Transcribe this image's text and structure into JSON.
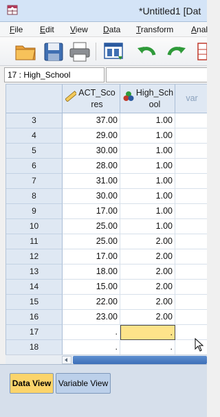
{
  "window": {
    "title": "*Untitled1 [Dat"
  },
  "menu": [
    {
      "label_u": "F",
      "label_rest": "ile"
    },
    {
      "label_u": "E",
      "label_rest": "dit"
    },
    {
      "label_u": "V",
      "label_rest": "iew"
    },
    {
      "label_u": "D",
      "label_rest": "ata"
    },
    {
      "label_u": "T",
      "label_rest": "ransform"
    },
    {
      "label_u": "A",
      "label_rest": "nal"
    }
  ],
  "toolbar": {
    "icons": [
      "open-folder-icon",
      "save-icon",
      "print-icon",
      "dialog-recall-icon",
      "undo-icon",
      "redo-icon",
      "goto-case-icon"
    ]
  },
  "reference_bar": {
    "cell_ref": "17 : High_School",
    "cell_value": ""
  },
  "grid": {
    "columns": [
      {
        "label_line1": "ACT_Sco",
        "label_line2": "res",
        "icon": "scale-ruler-icon"
      },
      {
        "label_line1": "High_Sch",
        "label_line2": "ool",
        "icon": "nominal-circles-icon"
      },
      {
        "label_line1": "var",
        "label_line2": ""
      }
    ],
    "rows": [
      {
        "num": "3",
        "act": "37.00",
        "hs": "1.00"
      },
      {
        "num": "4",
        "act": "29.00",
        "hs": "1.00"
      },
      {
        "num": "5",
        "act": "30.00",
        "hs": "1.00"
      },
      {
        "num": "6",
        "act": "28.00",
        "hs": "1.00"
      },
      {
        "num": "7",
        "act": "31.00",
        "hs": "1.00"
      },
      {
        "num": "8",
        "act": "30.00",
        "hs": "1.00"
      },
      {
        "num": "9",
        "act": "17.00",
        "hs": "1.00"
      },
      {
        "num": "10",
        "act": "25.00",
        "hs": "1.00"
      },
      {
        "num": "11",
        "act": "25.00",
        "hs": "2.00"
      },
      {
        "num": "12",
        "act": "17.00",
        "hs": "2.00"
      },
      {
        "num": "13",
        "act": "18.00",
        "hs": "2.00"
      },
      {
        "num": "14",
        "act": "15.00",
        "hs": "2.00"
      },
      {
        "num": "15",
        "act": "22.00",
        "hs": "2.00"
      },
      {
        "num": "16",
        "act": "23.00",
        "hs": "2.00"
      },
      {
        "num": "17",
        "act": ".",
        "hs": "."
      },
      {
        "num": "18",
        "act": ".",
        "hs": "."
      }
    ]
  },
  "tabs": {
    "data_view": "Data View",
    "variable_view": "Variable View"
  },
  "colors": {
    "selected_cell": "#fde38a",
    "header_bg": "#dfe8f3",
    "active_tab": "#fbd46b"
  }
}
